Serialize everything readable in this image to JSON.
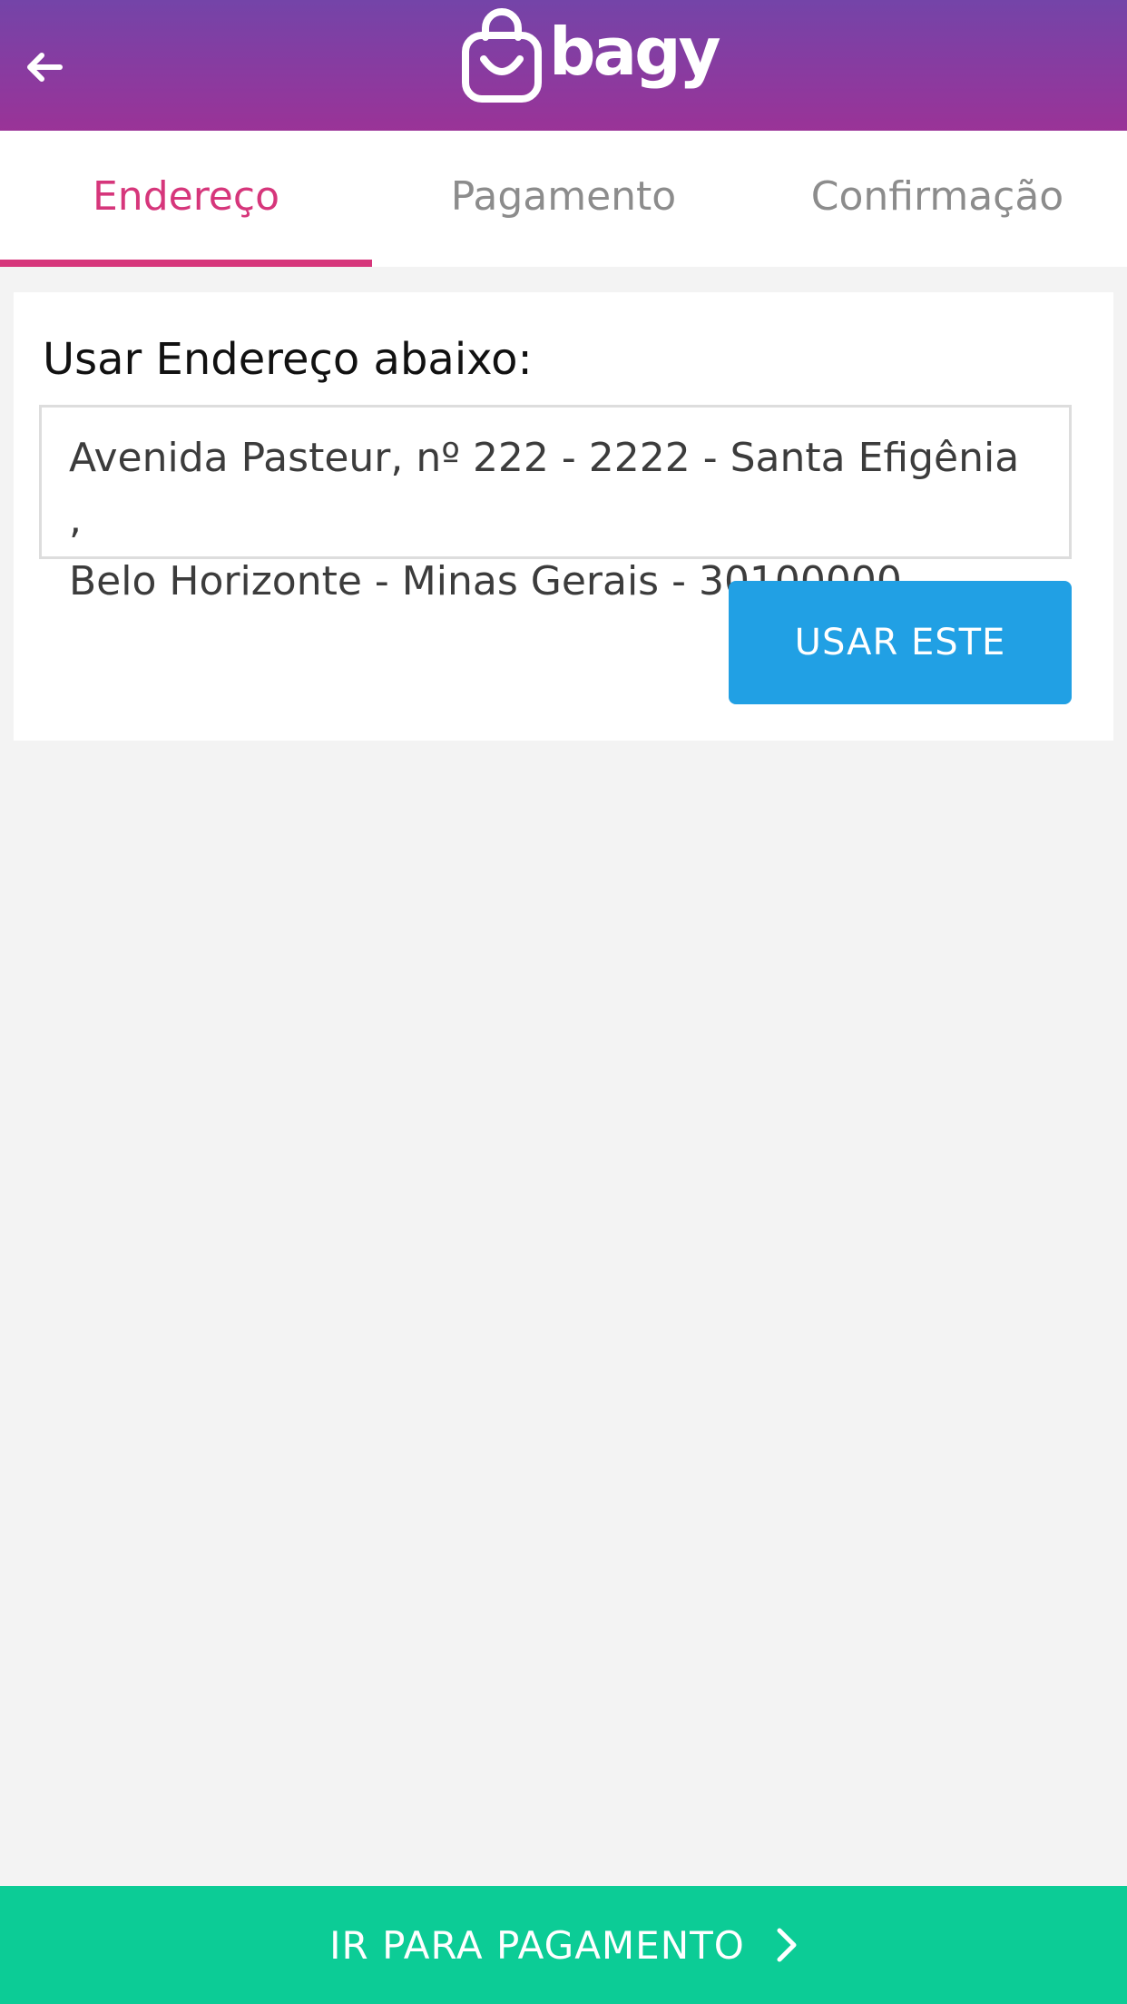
{
  "header": {
    "logo_text": "bagy",
    "back_icon": "arrow-left-icon",
    "logo_icon": "shopping-bag-icon"
  },
  "tabs": [
    {
      "label": "Endereço",
      "active": true
    },
    {
      "label": "Pagamento",
      "active": false
    },
    {
      "label": "Confirmação",
      "active": false
    }
  ],
  "address_card": {
    "label": "Usar Endereço abaixo:",
    "address_line1": "Avenida Pasteur, nº 222 - 2222 - Santa Efigênia ,",
    "address_line2": "Belo Horizonte - Minas Gerais - 30100000",
    "use_button_label": "USAR ESTE"
  },
  "footer": {
    "next_label": "IR PARA PAGAMENTO",
    "next_icon": "chevron-right-icon"
  },
  "colors": {
    "header_gradient_top": "#7444a8",
    "header_gradient_bottom": "#9a3397",
    "tab_active": "#d6367b",
    "tab_inactive": "#8c8c8c",
    "use_button": "#21a0e4",
    "footer": "#0ccc96",
    "background": "#f3f3f3"
  }
}
